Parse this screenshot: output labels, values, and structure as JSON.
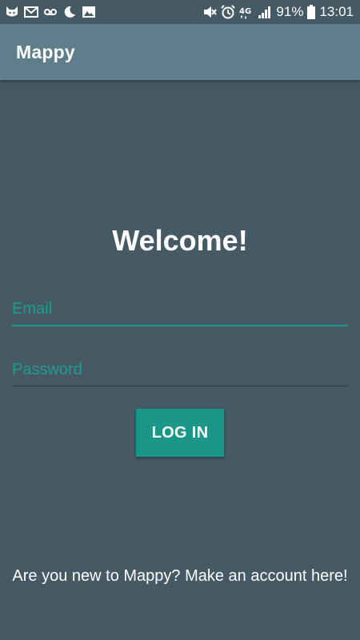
{
  "status_bar": {
    "left_icons": [
      "cat-icon",
      "mail-icon",
      "voicemail-icon",
      "moon-icon",
      "image-icon"
    ],
    "right_icons": [
      "mute-icon",
      "alarm-icon",
      "network-4g-icon",
      "signal-icon"
    ],
    "battery": "91%",
    "time": "13:01"
  },
  "app_bar": {
    "title": "Mappy"
  },
  "login": {
    "heading": "Welcome!",
    "email_placeholder": "Email",
    "password_placeholder": "Password",
    "login_label": "LOG IN",
    "signup_text": "Are you new to Mappy? Make an account here!"
  },
  "colors": {
    "background": "#455a64",
    "app_bar": "#607d8b",
    "accent": "#1b9688"
  }
}
